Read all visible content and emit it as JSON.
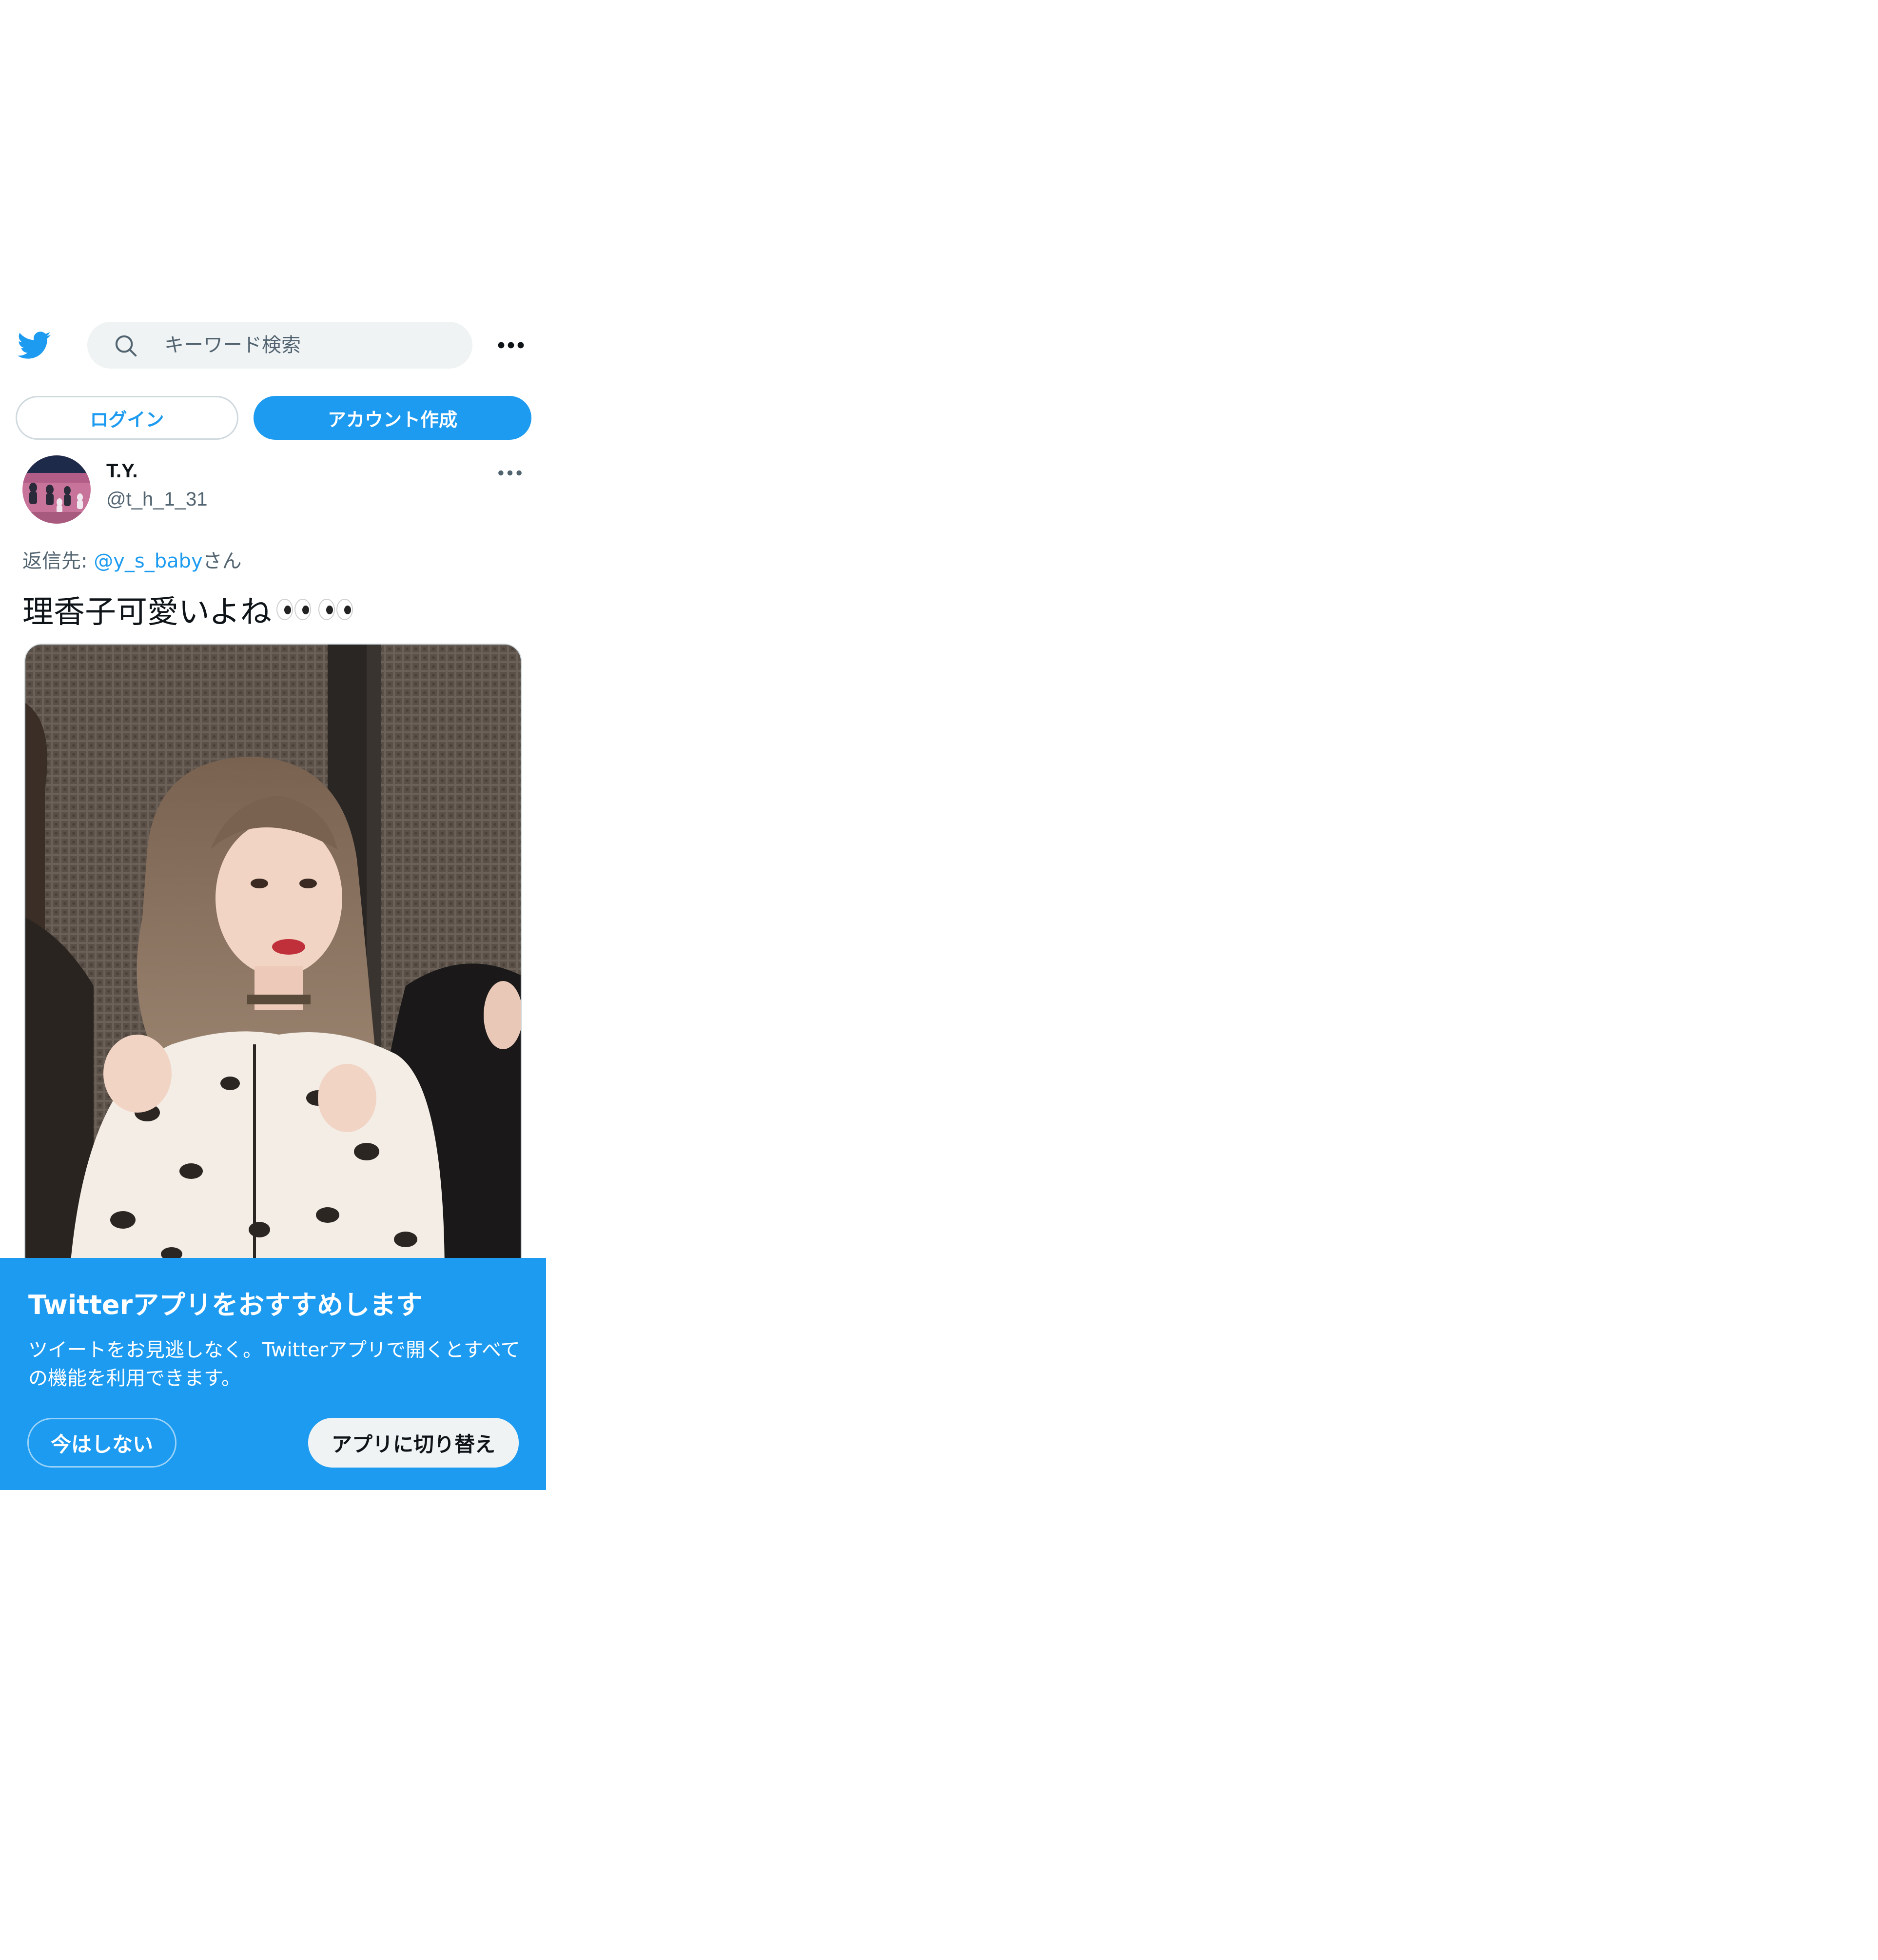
{
  "header": {
    "search_placeholder": "キーワード検索"
  },
  "auth": {
    "login_label": "ログイン",
    "signup_label": "アカウント作成"
  },
  "tweet": {
    "author_name": "T.Y.",
    "author_handle": "@t_h_1_31",
    "reply_prefix": "返信先: ",
    "reply_handle": "@y_s_baby",
    "reply_suffix": "さん",
    "text": "理香子可愛いよね",
    "emoji_icon": "eyes-icon",
    "emoji_count": 2
  },
  "app_banner": {
    "title": "Twitterアプリをおすすめします",
    "description": "ツイートをお見逃しなく。Twitterアプリで開くとすべての機能を利用できます。",
    "not_now_label": "今はしない",
    "switch_label": "アプリに切り替え"
  },
  "colors": {
    "brand_blue": "#1d9bf0",
    "text_primary": "#0f1419",
    "text_secondary": "#536471",
    "search_bg": "#eff3f4"
  }
}
